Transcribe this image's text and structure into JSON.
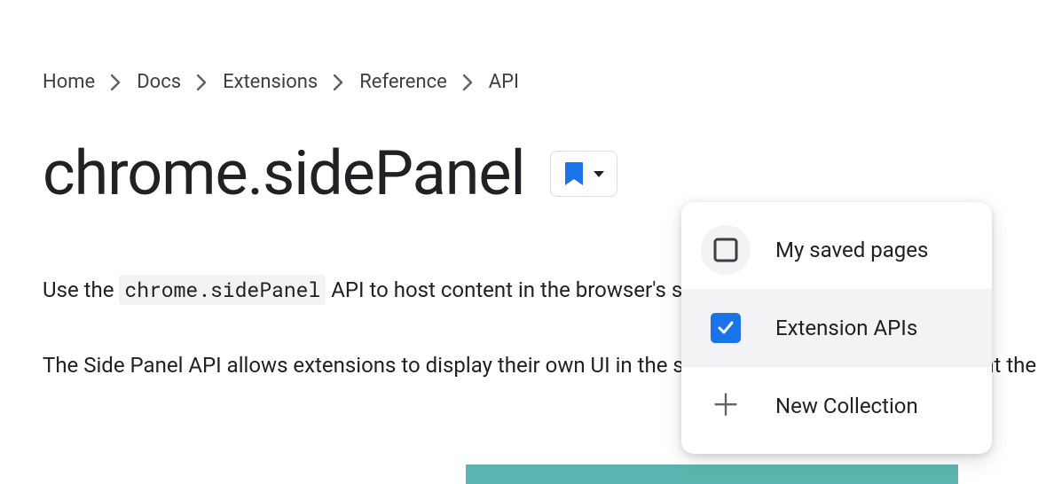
{
  "breadcrumb": {
    "items": [
      {
        "label": "Home"
      },
      {
        "label": "Docs"
      },
      {
        "label": "Extensions"
      },
      {
        "label": "Reference"
      },
      {
        "label": "API"
      }
    ]
  },
  "page": {
    "title": "chrome.sidePanel"
  },
  "body": {
    "p1_pre": "Use the ",
    "p1_code": "chrome.sidePanel",
    "p1_post": " API to host content in the browser's side panel alongside th",
    "p2": "The Side Panel API allows extensions to display their own UI in the side panel, enabling p complement the user's browsing journey."
  },
  "bookmark_menu": {
    "items": [
      {
        "label": "My saved pages",
        "checked": false
      },
      {
        "label": "Extension APIs",
        "checked": true
      },
      {
        "label": "New Collection",
        "action": "new"
      }
    ]
  }
}
